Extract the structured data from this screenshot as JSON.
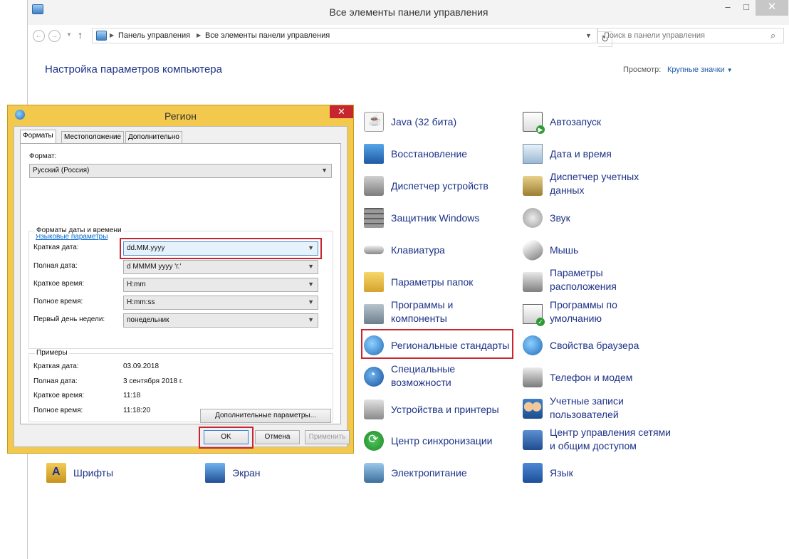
{
  "window": {
    "title": "Все элементы панели управления",
    "min": "–",
    "max": "□",
    "close": "✕"
  },
  "address": {
    "crumbs": [
      "Панель управления",
      "Все элементы панели управления"
    ],
    "search_placeholder": "Поиск в панели управления"
  },
  "header": {
    "title": "Настройка параметров компьютера",
    "view_label": "Просмотр:",
    "view_value": "Крупные значки"
  },
  "items": [
    {
      "label": "Java (32 бита)",
      "icon": "java-icon"
    },
    {
      "label": "Восстановление",
      "icon": "recovery-icon"
    },
    {
      "label": "Диспетчер устройств",
      "icon": "device-manager-icon"
    },
    {
      "label": "Защитник Windows",
      "icon": "defender-icon"
    },
    {
      "label": "Клавиатура",
      "icon": "keyboard-icon"
    },
    {
      "label": "Параметры папок",
      "icon": "folder-options-icon"
    },
    {
      "label": "Программы и компоненты",
      "icon": "programs-icon"
    },
    {
      "label": "Региональные стандарты",
      "icon": "region-icon",
      "highlighted": true
    },
    {
      "label": "Специальные возможности",
      "icon": "accessibility-icon"
    },
    {
      "label": "Устройства и принтеры",
      "icon": "printer-icon"
    },
    {
      "label": "Центр синхронизации",
      "icon": "sync-icon"
    },
    {
      "label": "Электропитание",
      "icon": "power-icon"
    },
    {
      "label": "Автозапуск",
      "icon": "autoplay-icon"
    },
    {
      "label": "Дата и время",
      "icon": "calendar-icon"
    },
    {
      "label": "Диспетчер учетных данных",
      "icon": "credential-icon"
    },
    {
      "label": "Звук",
      "icon": "sound-icon"
    },
    {
      "label": "Мышь",
      "icon": "mouse-icon"
    },
    {
      "label": "Параметры расположения",
      "icon": "location-icon"
    },
    {
      "label": "Программы по умолчанию",
      "icon": "default-programs-icon"
    },
    {
      "label": "Свойства браузера",
      "icon": "browser-icon"
    },
    {
      "label": "Телефон и модем",
      "icon": "phone-icon"
    },
    {
      "label": "Учетные записи пользователей",
      "icon": "users-icon"
    },
    {
      "label": "Центр управления сетями и общим доступом",
      "icon": "network-icon"
    },
    {
      "label": "Язык",
      "icon": "language-icon"
    },
    {
      "label": "Шрифты",
      "icon": "fonts-icon"
    },
    {
      "label": "Экран",
      "icon": "display-icon"
    }
  ],
  "dialog": {
    "title": "Регион",
    "close": "✕",
    "tabs": [
      "Форматы",
      "Местоположение",
      "Дополнительно"
    ],
    "format_label": "Формат:",
    "format_value": "Русский (Россия)",
    "lang_link": "Языковые параметры",
    "datetime_group": "Форматы даты и времени",
    "fields": [
      {
        "label": "Краткая дата:",
        "value": "dd.MM.yyyy",
        "highlighted": true
      },
      {
        "label": "Полная дата:",
        "value": "d MMMM yyyy 'г.'"
      },
      {
        "label": "Краткое время:",
        "value": "H:mm"
      },
      {
        "label": "Полное время:",
        "value": "H:mm:ss"
      },
      {
        "label": "Первый день недели:",
        "value": "понедельник"
      }
    ],
    "examples_group": "Примеры",
    "examples": [
      {
        "label": "Краткая дата:",
        "value": "03.09.2018"
      },
      {
        "label": "Полная дата:",
        "value": "3 сентября 2018 г."
      },
      {
        "label": "Краткое время:",
        "value": "11:18"
      },
      {
        "label": "Полное время:",
        "value": "11:18:20"
      }
    ],
    "more_button": "Дополнительные параметры...",
    "ok": "OK",
    "cancel": "Отмена",
    "apply": "Применить"
  }
}
